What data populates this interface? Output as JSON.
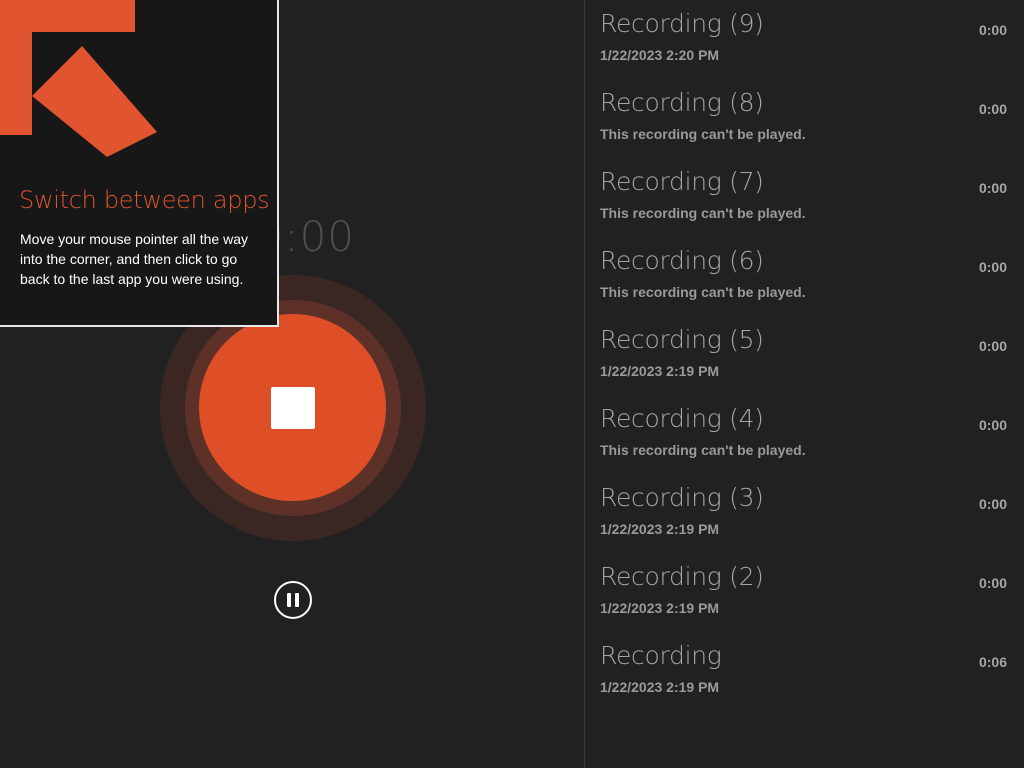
{
  "recorder": {
    "timer": "00:00",
    "stop_label": "stop",
    "pause_label": "pause"
  },
  "tip": {
    "title": "Switch between apps",
    "body": "Move your mouse pointer all the way into the corner, and then click to go back to the last app you were using.",
    "arrow_color": "#e0552f"
  },
  "colors": {
    "background": "#212121",
    "accent": "#de4e27",
    "muted_text": "#a6a6a6"
  },
  "recordings": [
    {
      "title": "Recording (9)",
      "subtitle": "1/22/2023 2:20 PM",
      "duration": "0:00"
    },
    {
      "title": "Recording (8)",
      "subtitle": "This recording can't be played.",
      "duration": "0:00"
    },
    {
      "title": "Recording (7)",
      "subtitle": "This recording can't be played.",
      "duration": "0:00"
    },
    {
      "title": "Recording (6)",
      "subtitle": "This recording can't be played.",
      "duration": "0:00"
    },
    {
      "title": "Recording (5)",
      "subtitle": "1/22/2023 2:19 PM",
      "duration": "0:00"
    },
    {
      "title": "Recording (4)",
      "subtitle": "This recording can't be played.",
      "duration": "0:00"
    },
    {
      "title": "Recording (3)",
      "subtitle": "1/22/2023 2:19 PM",
      "duration": "0:00"
    },
    {
      "title": "Recording (2)",
      "subtitle": "1/22/2023 2:19 PM",
      "duration": "0:00"
    },
    {
      "title": "Recording",
      "subtitle": "1/22/2023 2:19 PM",
      "duration": "0:06"
    }
  ]
}
